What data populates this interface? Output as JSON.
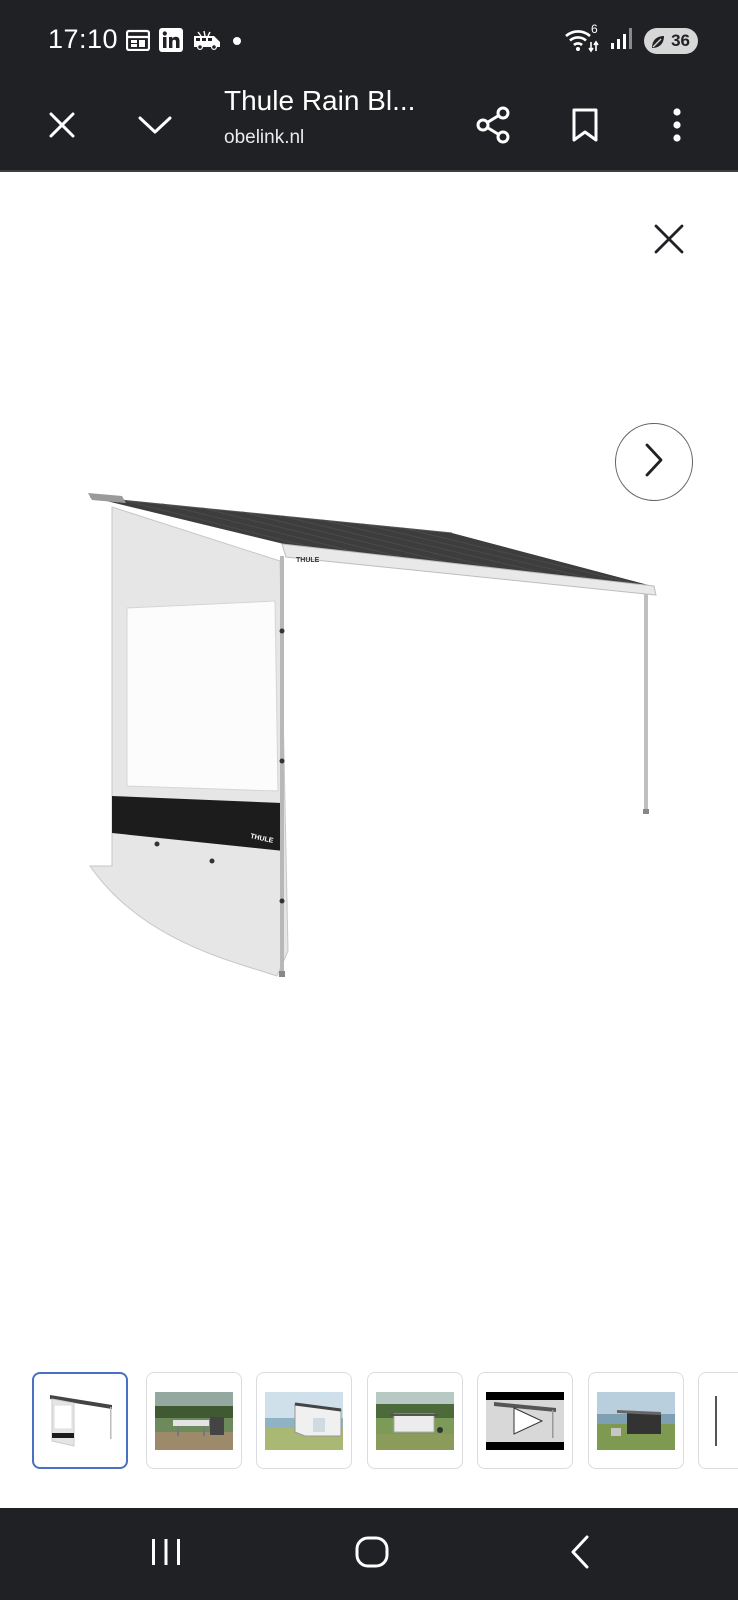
{
  "status_bar": {
    "time": "17:10",
    "left_icons": [
      "calendar-icon",
      "linkedin-icon",
      "camper-icon",
      "dot-icon"
    ],
    "signal_label": "6",
    "battery": "36"
  },
  "browser": {
    "title": "Thule Rain Bl...",
    "domain": "obelink.nl",
    "icons": [
      "close-icon",
      "chevron-down-icon",
      "share-icon",
      "bookmark-icon",
      "more-vert-icon"
    ]
  },
  "viewer": {
    "product_image": "awning-with-rain-blocker-side-panel",
    "brand_mark": "THULE",
    "icons": [
      "close-icon",
      "chevron-right-icon"
    ]
  },
  "thumbnails": {
    "selected_index": 0,
    "items": [
      {
        "name": "thumbnail-awning-product"
      },
      {
        "name": "thumbnail-camping-table"
      },
      {
        "name": "thumbnail-awning-lakeside"
      },
      {
        "name": "thumbnail-caravan-meadow"
      },
      {
        "name": "thumbnail-video",
        "type": "video"
      },
      {
        "name": "thumbnail-van-lake"
      },
      {
        "name": "thumbnail-partial"
      }
    ]
  },
  "navigation_bar": {
    "buttons": [
      "recent-apps-icon",
      "home-icon",
      "back-icon"
    ]
  },
  "colors": {
    "bar_background": "#202124",
    "selected_thumb_border": "#4a70c2",
    "awning_canvas": "#3d3d3d"
  }
}
